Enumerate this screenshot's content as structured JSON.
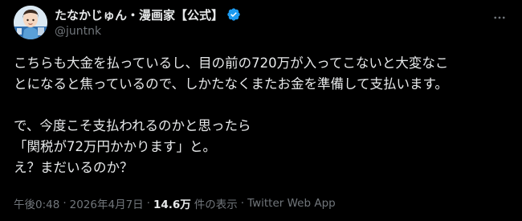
{
  "author": {
    "display_name": "たなかじゅん・漫画家【公式】",
    "handle": "@juntnk",
    "verified_color": "#1d9bf0"
  },
  "tweet": {
    "lines": [
      "こちらも大金を払っているし、目の前の720万が入ってこないと大変なこ",
      "とになると焦っているので、しかたなくまたお金を準備して支払います。",
      "",
      "で、今度こそ支払われるのかと思ったら",
      "「関税が72万円かかります」と。",
      "え？まだいるのか？"
    ]
  },
  "meta": {
    "time": "午後0:48",
    "date": "2026年4月7日",
    "views_count": "14.6万",
    "views_label": "件の表示",
    "source": "Twitter Web App",
    "separator": "·"
  },
  "icons": {
    "more": "more-options-icon",
    "verified": "verified-badge-icon"
  }
}
